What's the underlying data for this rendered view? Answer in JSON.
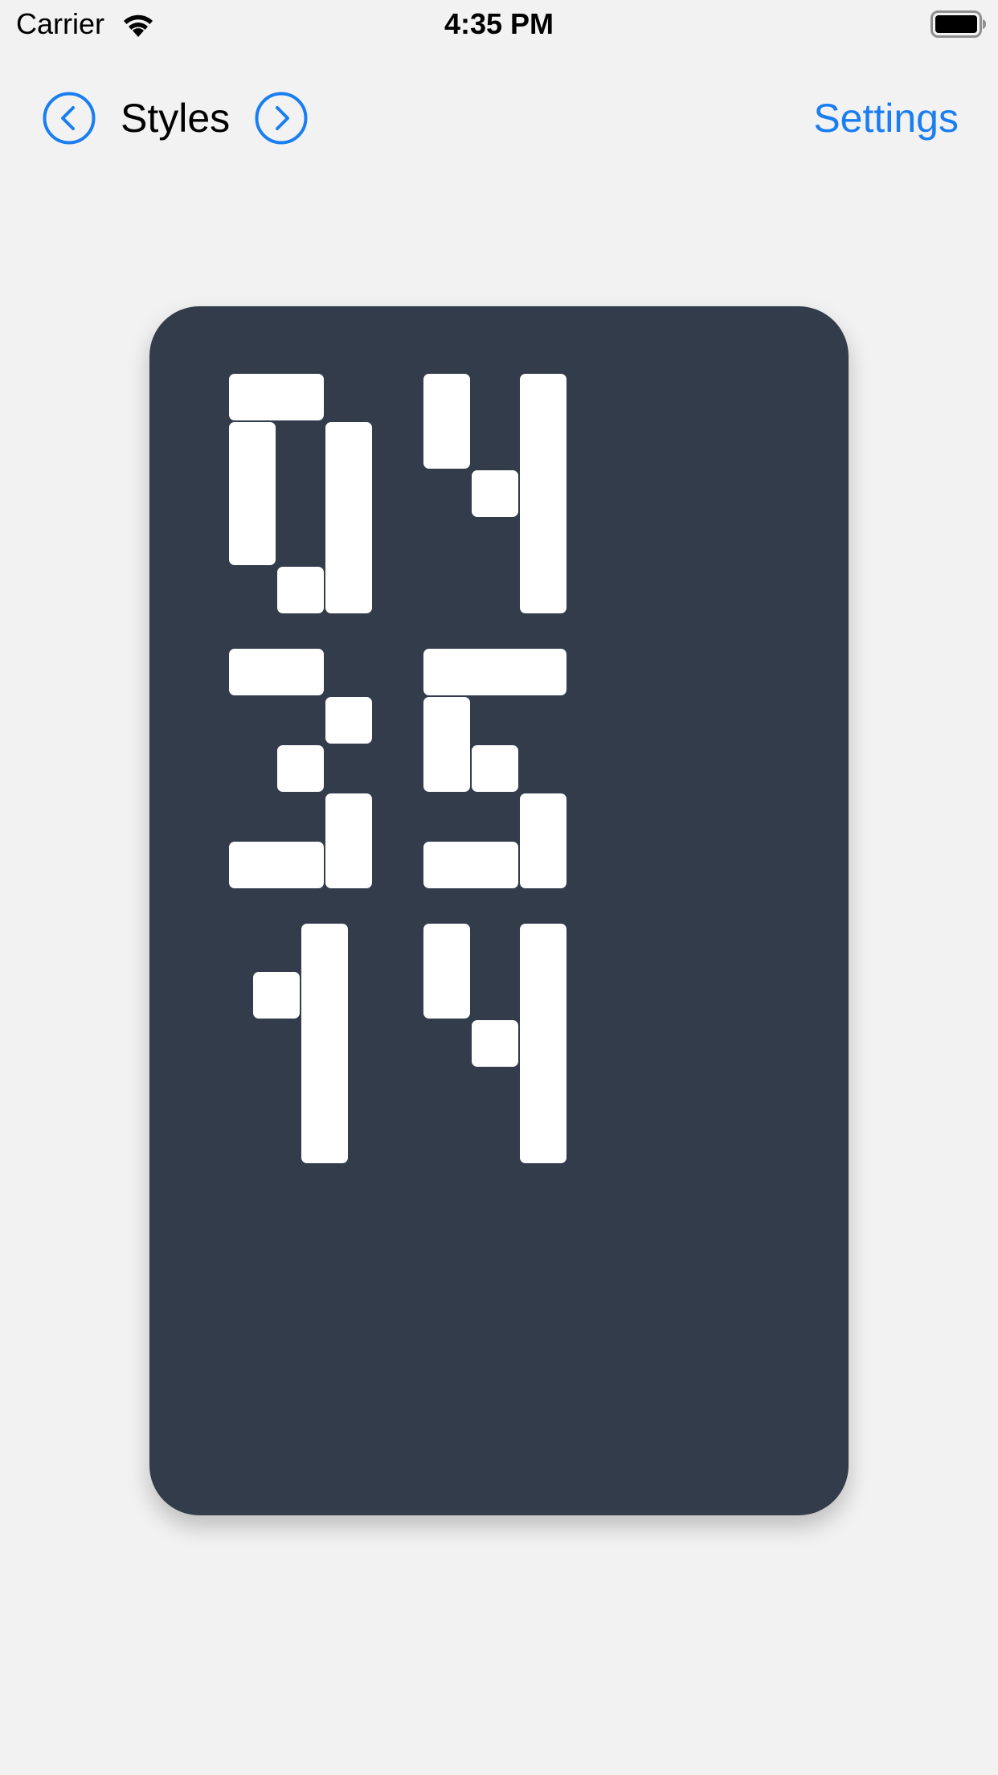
{
  "status_bar": {
    "carrier": "Carrier",
    "time": "4:35 PM"
  },
  "nav": {
    "title": "Styles",
    "settings_label": "Settings",
    "accent_color": "#1a7ef0"
  },
  "clock": {
    "digits": [
      "0",
      "4",
      "3",
      "5",
      "1",
      "4"
    ],
    "hours": "04",
    "minutes": "35",
    "seconds": "14",
    "card_color": "#323c4b",
    "segment_color": "#ffffff"
  }
}
